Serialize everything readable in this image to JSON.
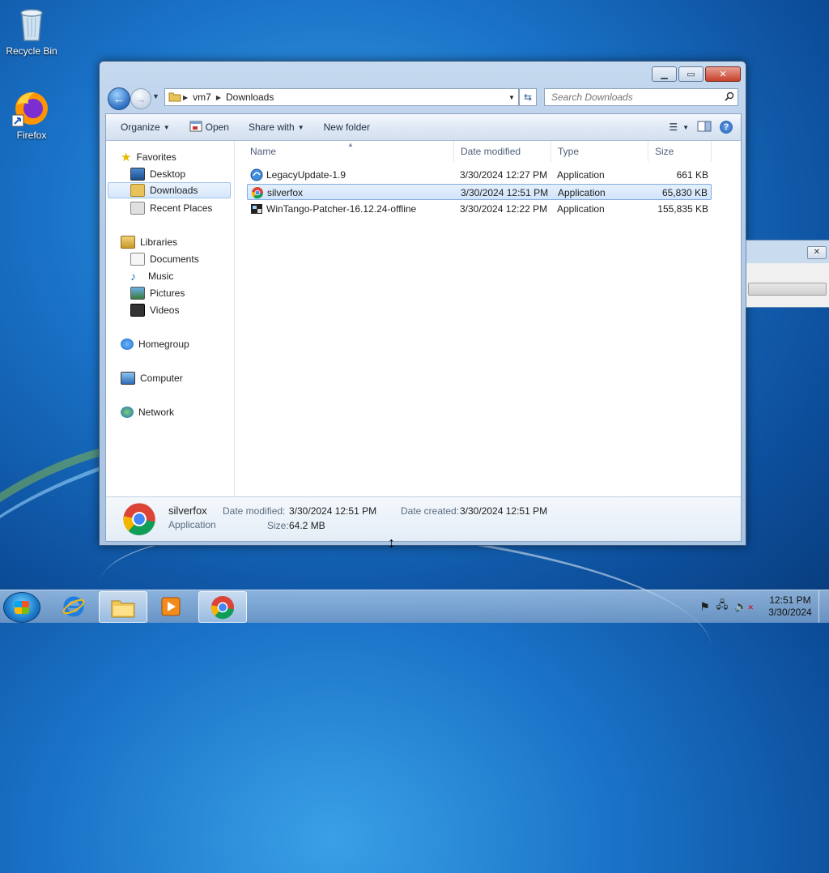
{
  "desktop": {
    "icons": [
      {
        "label": "Recycle Bin"
      },
      {
        "label": "Firefox"
      }
    ]
  },
  "window": {
    "address": {
      "crumbs": [
        "vm7",
        "Downloads"
      ]
    },
    "search": {
      "placeholder": "Search Downloads"
    },
    "toolbar": {
      "organize": "Organize",
      "open": "Open",
      "share_with": "Share with",
      "new_folder": "New folder"
    },
    "nav": {
      "favorites": "Favorites",
      "desktop": "Desktop",
      "downloads": "Downloads",
      "recent_places": "Recent Places",
      "libraries": "Libraries",
      "documents": "Documents",
      "music": "Music",
      "pictures": "Pictures",
      "videos": "Videos",
      "homegroup": "Homegroup",
      "computer": "Computer",
      "network": "Network"
    },
    "columns": {
      "name": "Name",
      "date_modified": "Date modified",
      "type": "Type",
      "size": "Size"
    },
    "files": [
      {
        "name": "LegacyUpdate-1.9",
        "date": "3/30/2024 12:27 PM",
        "type": "Application",
        "size": "661 KB",
        "icon": "legacy-update-icon"
      },
      {
        "name": "silverfox",
        "date": "3/30/2024 12:51 PM",
        "type": "Application",
        "size": "65,830 KB",
        "icon": "chrome-icon",
        "selected": true
      },
      {
        "name": "WinTango-Patcher-16.12.24-offline",
        "date": "3/30/2024 12:22 PM",
        "type": "Application",
        "size": "155,835 KB",
        "icon": "wintango-icon"
      }
    ],
    "details": {
      "name": "silverfox",
      "type": "Application",
      "date_modified_label": "Date modified:",
      "date_modified": "3/30/2024 12:51 PM",
      "date_created_label": "Date created:",
      "date_created": "3/30/2024 12:51 PM",
      "size_label": "Size:",
      "size": "64.2 MB"
    }
  },
  "taskbar": {
    "clock_time": "12:51 PM",
    "clock_date": "3/30/2024"
  },
  "colors": {
    "accent": "#1a73c8",
    "selection": "#d0e4fb"
  }
}
